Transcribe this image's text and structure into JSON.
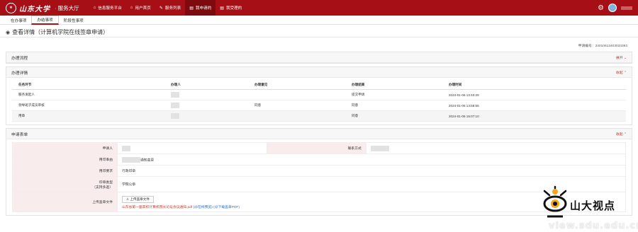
{
  "header": {
    "logo_text": "山东大学",
    "logo_sub": "· 服务大厅",
    "nav": [
      {
        "icon": "⌂",
        "label": "信息服务平台"
      },
      {
        "icon": "⌂",
        "label": "用户首页"
      },
      {
        "icon": "✎",
        "label": "服务列表"
      },
      {
        "icon": "▤",
        "label": "我申请的"
      },
      {
        "icon": "▤",
        "label": "我受理的"
      }
    ]
  },
  "tabs": [
    "在办事项",
    "办结事项",
    "阶段性事项"
  ],
  "page_title": "查看详情（计算机学院在线签章申请）",
  "application_no": "申请编号：24010613403033393",
  "flow_panel": {
    "title": "办理流程",
    "toggle": "展开 ⌄"
  },
  "detail_panel": {
    "title": "办理详情",
    "toggle": "收起 ⌃",
    "columns": [
      "任务环节",
      "办理人",
      "办理意见",
      "办理结果",
      "办理时间"
    ],
    "rows": [
      {
        "step": "服务发起人",
        "opinion": "",
        "result": "提交申请",
        "time": "2024-01-06 13:40:29"
      },
      {
        "step": "领导班子成员审核",
        "opinion": "同意",
        "result": "同意",
        "time": "2024-01-06 14:58:55"
      },
      {
        "step": "用章",
        "opinion": "",
        "result": "同意",
        "time": "2024-01-06 15:07:10"
      }
    ]
  },
  "form_panel": {
    "title": "申请表单",
    "toggle": "收起 ⌃",
    "applicant_label": "申请人",
    "contact_label": "联系方式",
    "reason_label": "用印事由",
    "reason_value": "通知盖章",
    "requirement_label": "用印要求",
    "requirement_value": "行政印章",
    "seal_type_label": "印章类型",
    "seal_type_label2": "（支持多选）",
    "seal_type_value": "学院公章",
    "upload_label": "上传盖章文件",
    "upload_button": "上传盖章文件",
    "file_name": "山东省第一届高校计算机院长论坛会议通知.pdf",
    "preview_link": "(@在线预览)",
    "download_link": "(@下载盖章PDF)"
  },
  "watermark": {
    "name": "山大视点",
    "url": "view.sdu.edu.cn",
    "side": "cn"
  }
}
